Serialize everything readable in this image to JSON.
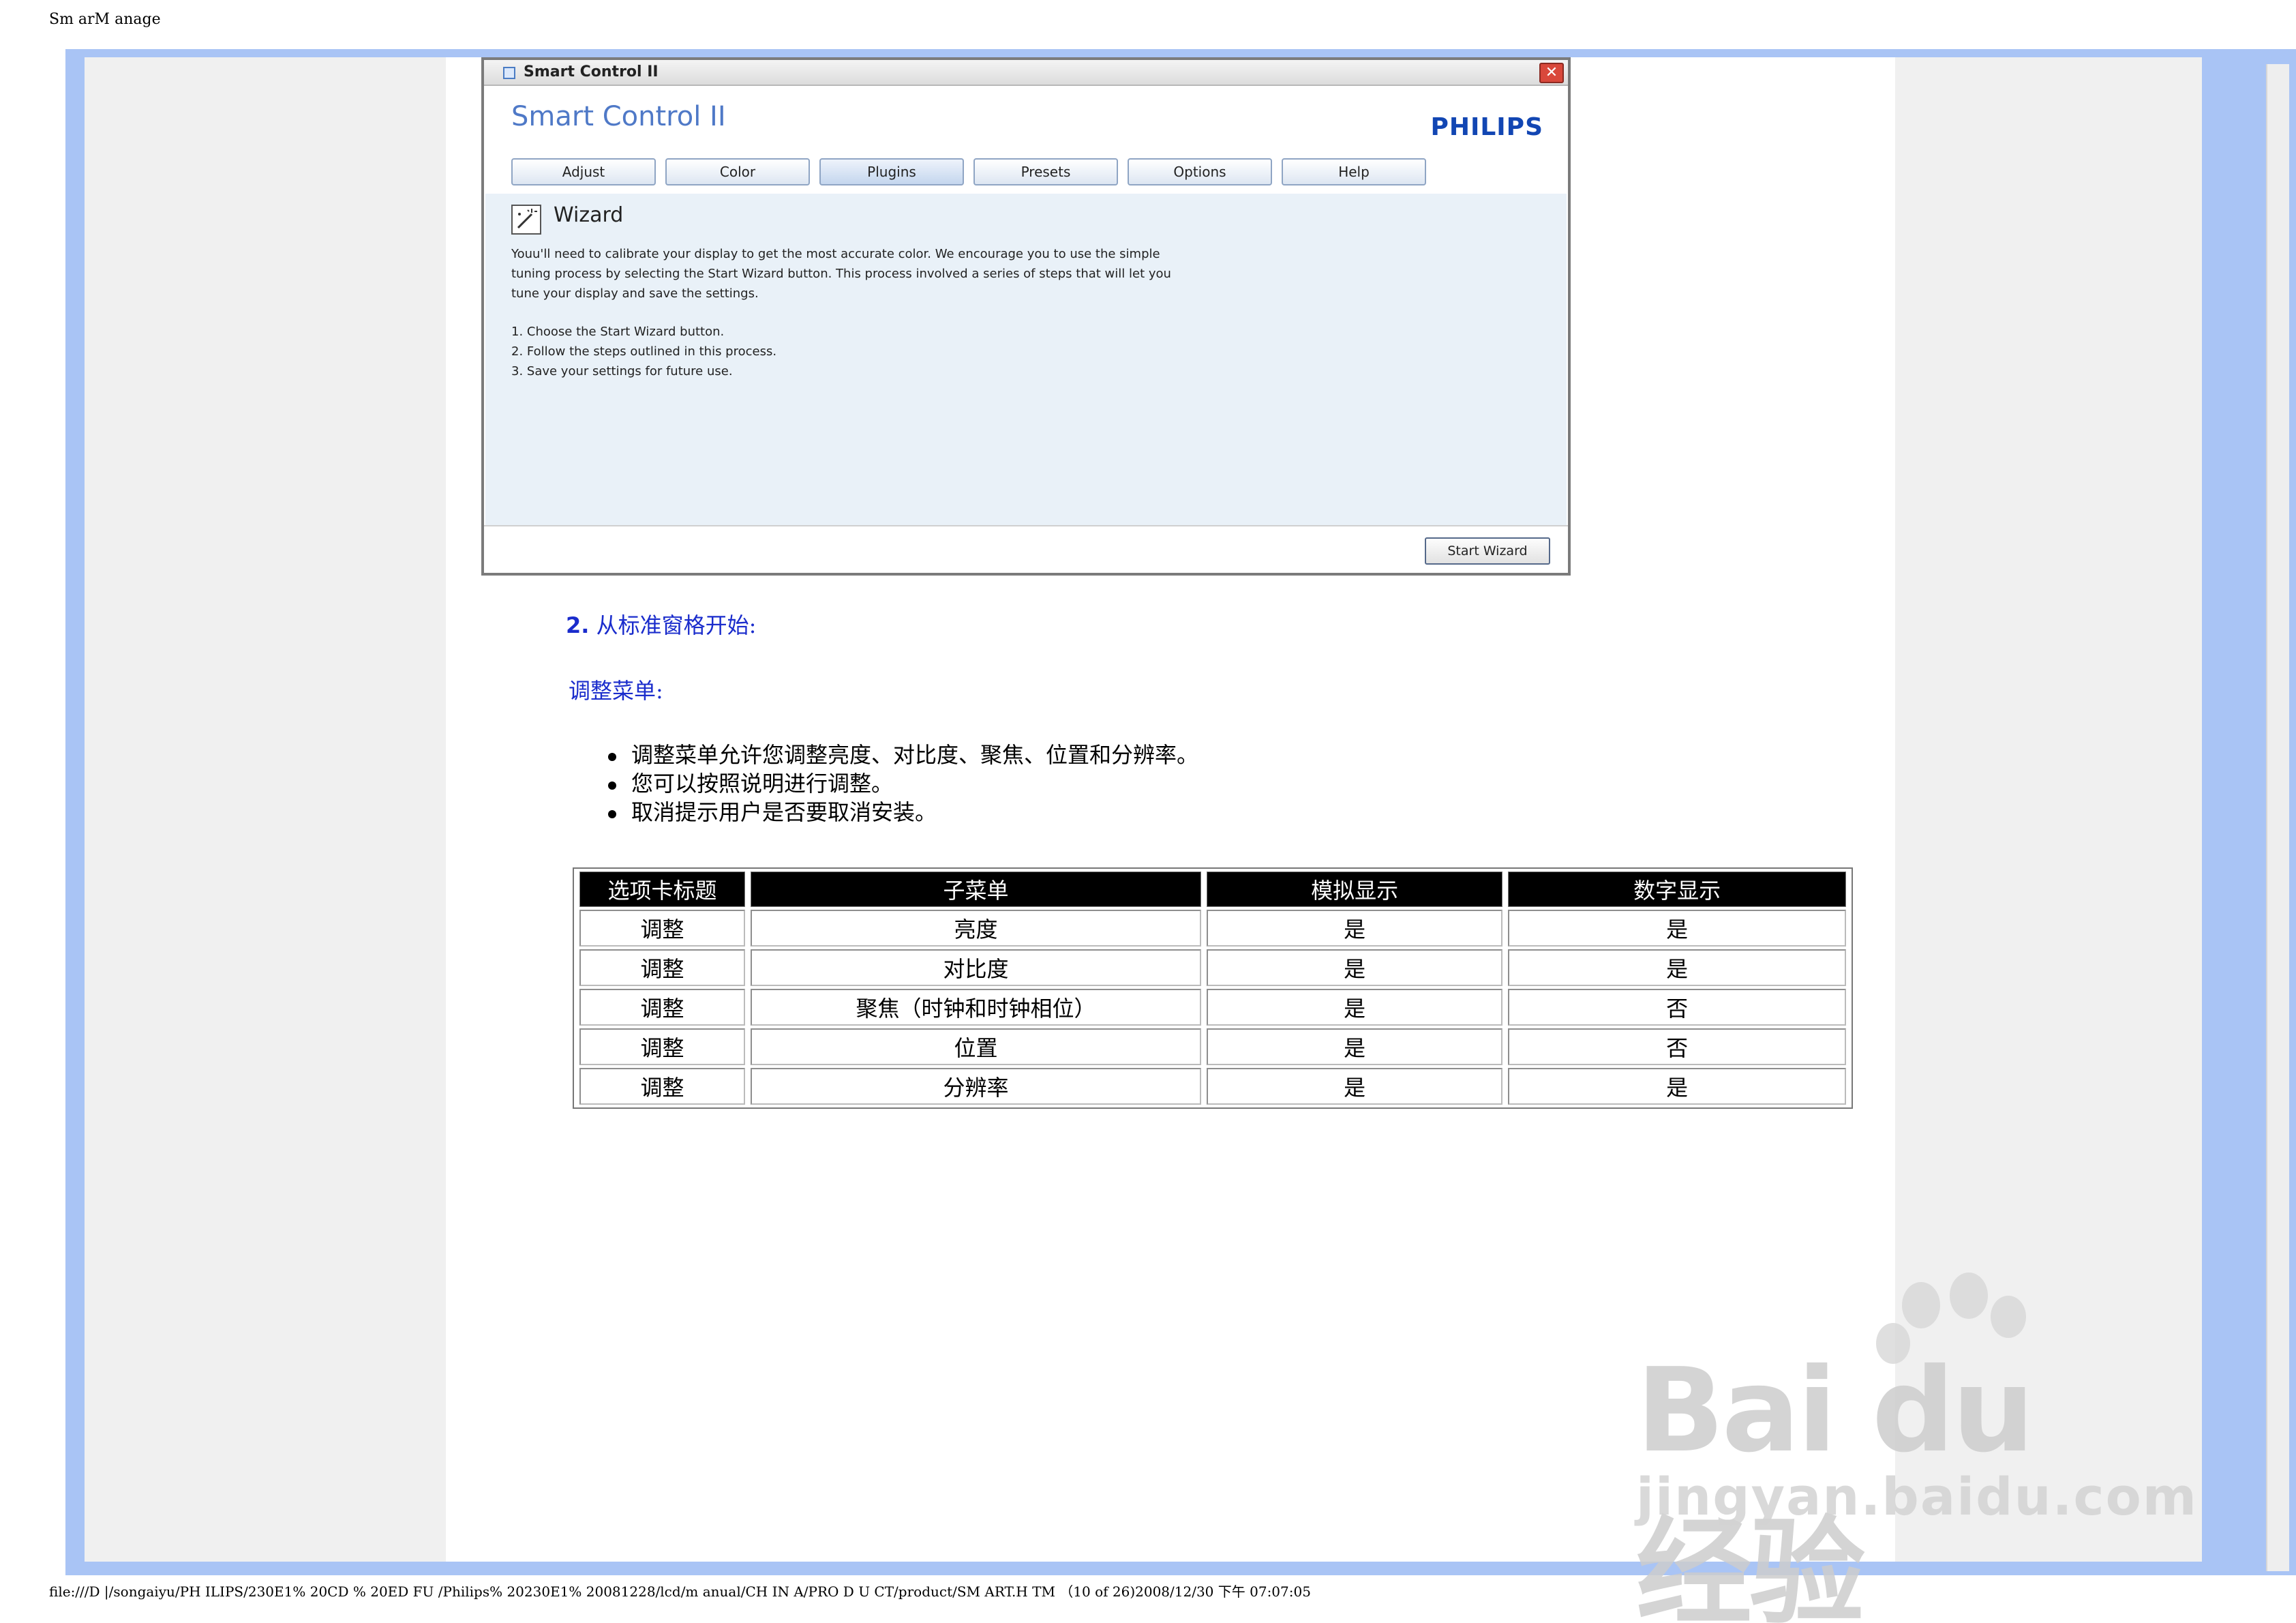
{
  "header": {
    "title": "Sm arM anage"
  },
  "smart_control": {
    "window_title": "Smart Control II",
    "close_glyph": "✕",
    "brand": "Smart Control II",
    "logo": "PHILIPS",
    "tabs": [
      "Adjust",
      "Color",
      "Plugins",
      "Presets",
      "Options",
      "Help"
    ],
    "active_tab": "Plugins",
    "wizard_title": "Wizard",
    "wizard_text": "Youu'll need to calibrate your display to get the most accurate color. We encourage you to use the simple tuning process by selecting the Start Wizard button. This process involved a series of steps that will let you tune your display and save the settings.",
    "steps": [
      "1. Choose the Start Wizard button.",
      "2. Follow the steps outlined in this process.",
      "3. Save your settings for future use."
    ],
    "start_button": "Start Wizard"
  },
  "section": {
    "number": "2.",
    "heading": "从标准窗格开始:"
  },
  "subheading": "调整菜单:",
  "bullets": [
    "调整菜单允许您调整亮度、对比度、聚焦、位置和分辨率。",
    "您可以按照说明进行调整。",
    "取消提示用户是否要取消安装。"
  ],
  "table": {
    "headers": [
      "选项卡标题",
      "子菜单",
      "模拟显示",
      "数字显示"
    ],
    "rows": [
      [
        "调整",
        "亮度",
        "是",
        "是"
      ],
      [
        "调整",
        "对比度",
        "是",
        "是"
      ],
      [
        "调整",
        "聚焦（时钟和时钟相位）",
        "是",
        "否"
      ],
      [
        "调整",
        "位置",
        "是",
        "否"
      ],
      [
        "调整",
        "分辨率",
        "是",
        "是"
      ]
    ]
  },
  "footer": {
    "path": "file:///D |/songaiyu/PH ILIPS/230E1% 20CD % 20ED FU /Philips% 20230E1% 20081228/lcd/m anual/CH IN A/PRO D U CT/product/SM ART.H TM （10 of 26)2008/12/30 下午 07:07:05"
  },
  "watermark": {
    "main": "Bai du 经验",
    "sub": "jingyan.baidu.com"
  },
  "colors": {
    "frame_blue": "#a9c4f5",
    "heading_blue": "#1a2ccc",
    "philips_blue": "#1246b3"
  }
}
